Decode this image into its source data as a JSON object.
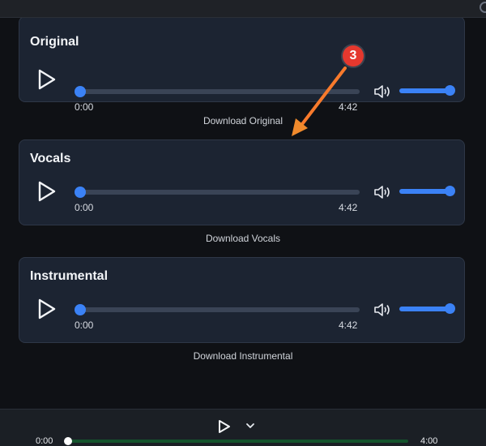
{
  "tracks": [
    {
      "title": "Original",
      "current_time": "0:00",
      "duration": "4:42",
      "download_label": "Download Original",
      "progress": 0,
      "volume": 1.0
    },
    {
      "title": "Vocals",
      "current_time": "0:00",
      "duration": "4:42",
      "download_label": "Download Vocals",
      "progress": 0,
      "volume": 1.0
    },
    {
      "title": "Instrumental",
      "current_time": "0:00",
      "duration": "4:42",
      "download_label": "Download Instrumental",
      "progress": 0,
      "volume": 1.0
    }
  ],
  "annotation": {
    "badge": "3",
    "color": "#e5382e"
  },
  "player": {
    "current_time": "0:00",
    "duration": "4:00",
    "progress": 0
  },
  "colors": {
    "accent": "#3b82f6",
    "card_bg": "#1c2432",
    "page_bg": "#0f1115"
  },
  "icons": {
    "play": "play-icon",
    "volume": "volume-icon",
    "chevron": "chevron-down-icon"
  }
}
